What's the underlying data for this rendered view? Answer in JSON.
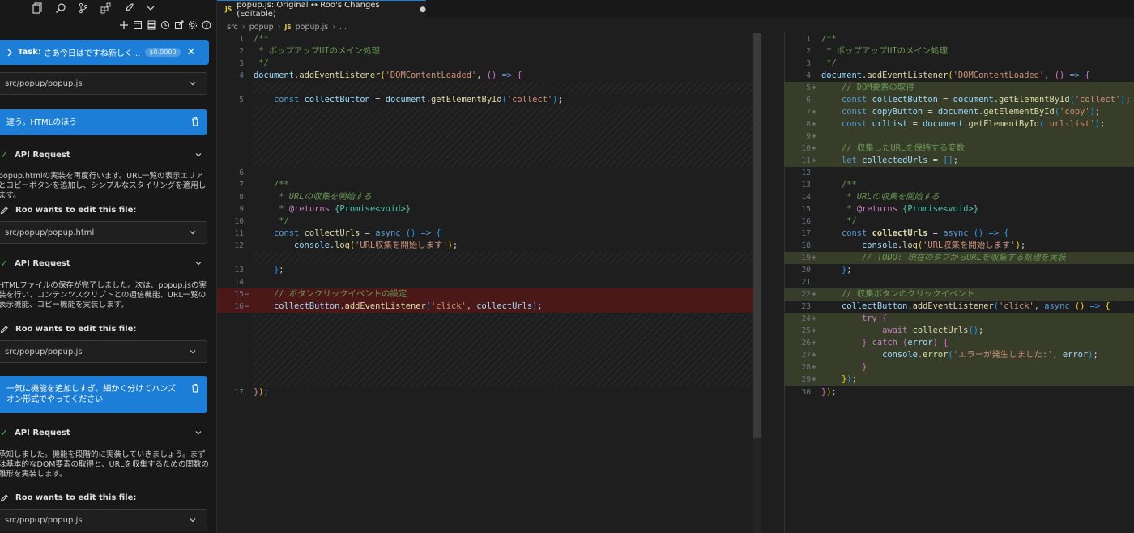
{
  "sidebar": {
    "task": {
      "label": "Task:",
      "text": "さあ今日はですね新しく...",
      "cost": "$0.0000"
    },
    "file1": "src/popup/popup.js",
    "user_msg1": "違う。HTMLのほう",
    "api1": "API Request",
    "api1_text": "popup.htmlの実装を再度行います。URL一覧の表示エリアとコピーボタンを追加し、シンプルなスタイリングを適用します。",
    "edit1": "Roo wants to edit this file:",
    "file2": "src/popup/popup.html",
    "api2": "API Request",
    "api2_text": "HTMLファイルの保存が完了しました。次は、popup.jsの実装を行い、コンテンツスクリプトとの通信機能、URL一覧の表示機能、コピー機能を実装します。",
    "edit2": "Roo wants to edit this file:",
    "file3": "src/popup/popup.js",
    "user_msg2": "一気に機能を追加しすぎ。細かく分けてハンズオン形式でやってください",
    "api3": "API Request",
    "api3_text": "承知しました。機能を段階的に実装していきましょう。まずは基本的なDOM要素の取得と、URLを収集するための関数の雛形を実装します。",
    "edit3": "Roo wants to edit this file:",
    "file4": "src/popup/popup.js"
  },
  "editor": {
    "tab_badge": "JS",
    "tab_title": "popup.js: Original ↔ Roo's Changes (Editable)",
    "tab_dot": "●",
    "breadcrumb": [
      "src",
      "popup",
      "popup.js",
      "..."
    ],
    "left_numbers": [
      "1",
      "2",
      "3",
      "4",
      "5",
      "6",
      "7",
      "8",
      "9",
      "10",
      "11",
      "12",
      "13",
      "14",
      "15",
      "16",
      "17"
    ],
    "right_numbers": [
      "1",
      "2",
      "3",
      "4",
      "5",
      "6",
      "7",
      "8",
      "9",
      "10",
      "11",
      "12",
      "13",
      "14",
      "15",
      "16",
      "17",
      "18",
      "19",
      "20",
      "21",
      "22",
      "23",
      "24",
      "25",
      "26",
      "27",
      "28",
      "29",
      "30"
    ],
    "strings": {
      "jsdoc_title": " * ポップアップUIのメイン処理",
      "dom_loaded": "'DOMContentLoaded'",
      "collect": "'collect'",
      "copy": "'copy'",
      "url_list": "'url-list'",
      "comment_dom": "// DOM要素の取得",
      "comment_urls": "// 収集したURLを保持する変数",
      "doc_start": "* URLの収集を開始する",
      "returns": "@returns",
      "promise": "{Promise<void>}",
      "log_msg": "'URL収集を開始します'",
      "todo": "// TODO: 現在のタブからURLを収集する処理を実装",
      "comment_click_old": "// ボタンクリックイベントの設定",
      "comment_click_new": "// 収集ボタンのクリックイベント",
      "click": "'click'",
      "error_msg": "'エラーが発生しました:'"
    }
  }
}
